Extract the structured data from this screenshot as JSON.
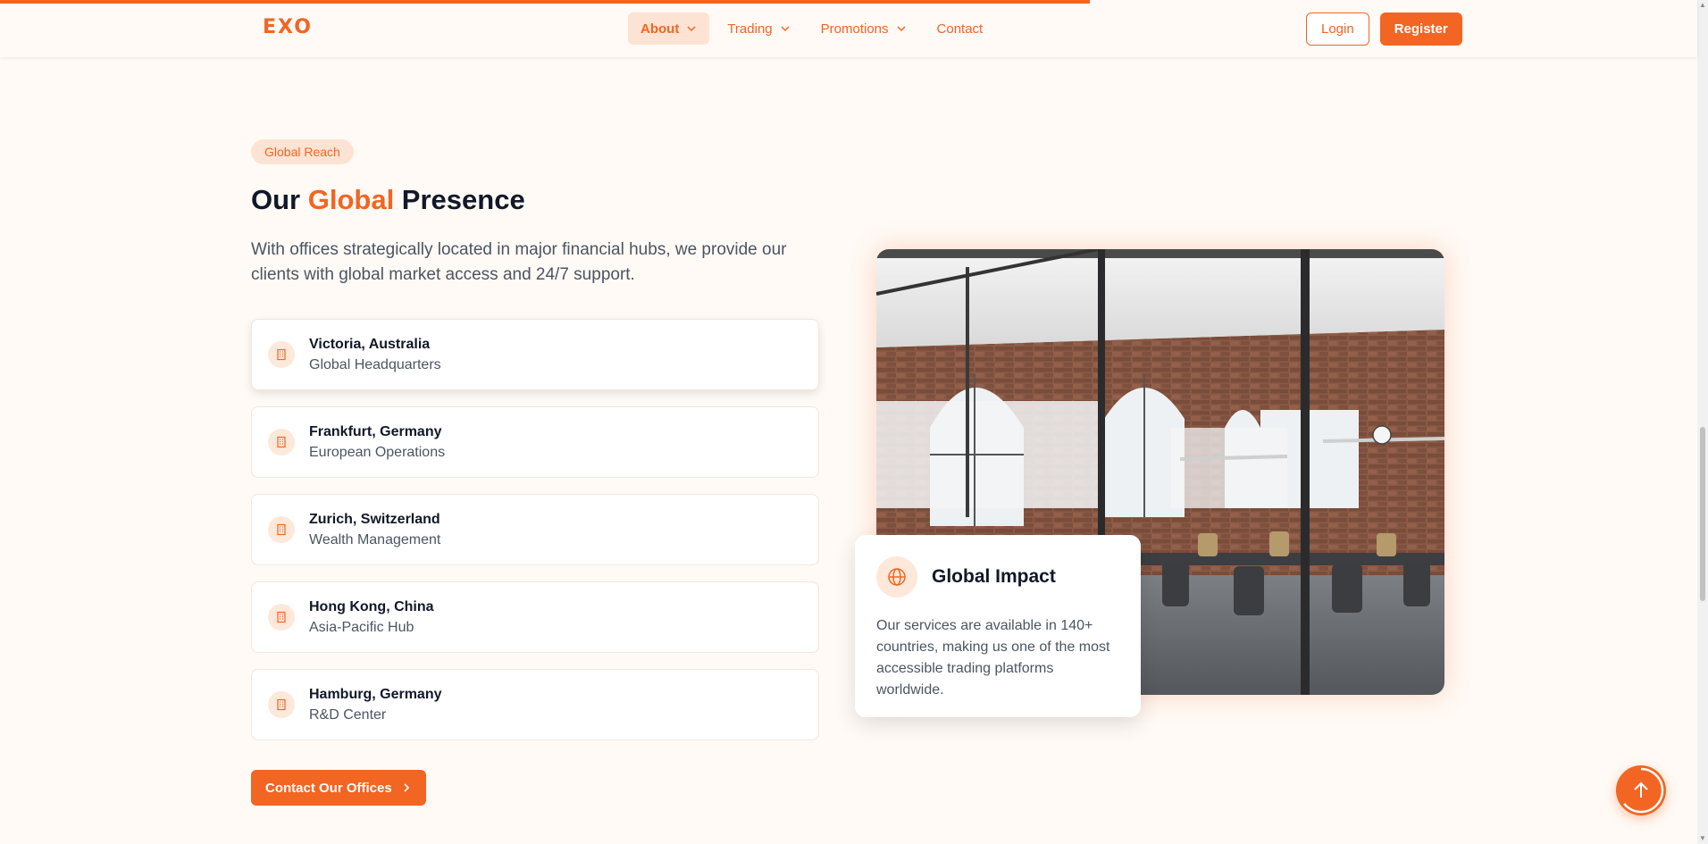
{
  "page": {
    "scroll_progress": 0.642
  },
  "nav": {
    "logo": "EXO",
    "items": [
      {
        "label": "About",
        "has_dropdown": true,
        "active": true
      },
      {
        "label": "Trading",
        "has_dropdown": true,
        "active": false
      },
      {
        "label": "Promotions",
        "has_dropdown": true,
        "active": false
      },
      {
        "label": "Contact",
        "has_dropdown": false,
        "active": false
      }
    ],
    "login_label": "Login",
    "register_label": "Register"
  },
  "section": {
    "badge": "Global Reach",
    "heading_pre": "Our ",
    "heading_accent": "Global",
    "heading_post": " Presence",
    "intro": "With offices strategically located in major financial hubs, we provide our clients with global market access and 24/7 support.",
    "offices": [
      {
        "name": "Victoria, Australia",
        "role": "Global Headquarters"
      },
      {
        "name": "Frankfurt, Germany",
        "role": "European Operations"
      },
      {
        "name": "Zurich, Switzerland",
        "role": "Wealth Management"
      },
      {
        "name": "Hong Kong, China",
        "role": "Asia-Pacific Hub"
      },
      {
        "name": "Hamburg, Germany",
        "role": "R&D Center"
      }
    ],
    "office_icon": "building-icon",
    "contact_button": "Contact Our Offices"
  },
  "impact": {
    "icon": "globe-icon",
    "title": "Global Impact",
    "text": "Our services are available in 140+ countries, making us one of the most accessible trading platforms worldwide."
  },
  "colors": {
    "accent": "#f26522",
    "accent_soft": "#fde3d3",
    "background": "#fffaf5",
    "text_dark": "#111827",
    "text_muted": "#4b5563"
  }
}
